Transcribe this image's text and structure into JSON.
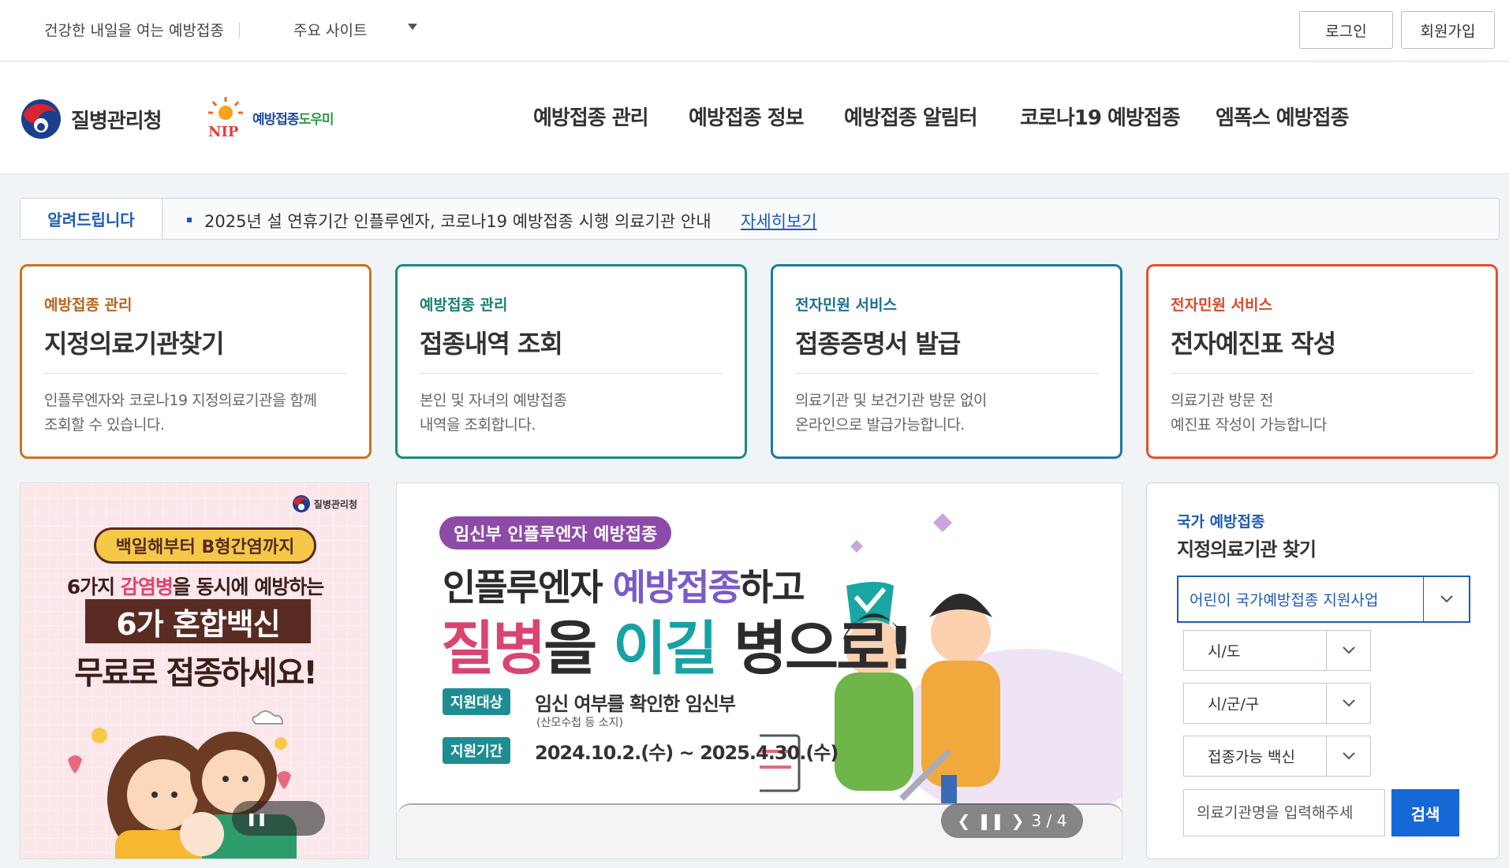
{
  "topbar": {
    "slogan": "건강한 내일을 여는 예방접종",
    "sites_label": "주요 사이트",
    "login": "로그인",
    "join": "회원가입"
  },
  "header": {
    "agency": "질병관리청",
    "nip_prefix": "예방접종",
    "nip_suffix": "도우미",
    "nip_mark": "NIP",
    "nav": [
      "예방접종 관리",
      "예방접종 정보",
      "예방접종 알림터",
      "코로나19 예방접종",
      "엠폭스 예방접종"
    ]
  },
  "notice": {
    "label": "알려드립니다",
    "message": "2025년 설 연휴기간 인플루엔자, 코로나19 예방접종 시행 의료기관 안내",
    "more": "자세히보기"
  },
  "cards": [
    {
      "category": "예방접종 관리",
      "title": "지정의료기관찾기",
      "desc1": "인플루엔자와 코로나19 지정의료기관을 함께",
      "desc2": "조회할 수 있습니다.",
      "color": "#c9741f",
      "cat_color": "#b5651d"
    },
    {
      "category": "예방접종 관리",
      "title": "접종내역 조회",
      "desc1": "본인 및 자녀의 예방접종",
      "desc2": "내역을 조회합니다.",
      "color": "#1a8a7e",
      "cat_color": "#17806f"
    },
    {
      "category": "전자민원 서비스",
      "title": "접종증명서 발급",
      "desc1": "의료기관 및 보건기관 방문 없이",
      "desc2": "온라인으로 발급가능합니다.",
      "color": "#1b7a9e",
      "cat_color": "#1b6f94"
    },
    {
      "category": "전자민원 서비스",
      "title": "전자예진표 작성",
      "desc1": "의료기관 방문 전",
      "desc2": "예진표 작성이 가능합니다",
      "color": "#e0532e",
      "cat_color": "#d9482a"
    }
  ],
  "banner_left": {
    "agency": "질병관리청",
    "pill": "백일해부터 B형간염까지",
    "line1_a": "6가지 ",
    "line1_b": "감염병",
    "line1_c": "을 동시에 예방하는",
    "line2": "6가 혼합백신",
    "line3": "무료로 접종하세요!",
    "pause": "❚❚"
  },
  "banner_main": {
    "tag": "임신부 인플루엔자 예방접종",
    "head1_a": "인플루엔자 ",
    "head1_b": "예방접종",
    "head1_c": "하고",
    "head2_a": "질병",
    "head2_b": "을 ",
    "head2_c": "이길",
    "head2_d": " 병으로!",
    "target_key": "지원대상",
    "target_val": "임신 여부를 확인한 임신부",
    "target_note": "(산모수첩 등 소지)",
    "period_key": "지원기간",
    "period_val": "2024.10.2.(수) ~ 2025.4.30.(수)",
    "pager_prev": "❮",
    "pager_pause": "❚❚",
    "pager_next": "❯",
    "pager_count": "3 / 4"
  },
  "finder": {
    "subtitle": "국가 예방접종",
    "title": "지정의료기관 찾기",
    "program": "어린이 국가예방접종 지원사업",
    "region1": "시/도",
    "region2": "시/군/구",
    "vaccine": "접종가능 백신",
    "query_placeholder": "의료기관명을 입력해주세",
    "search": "검색"
  }
}
